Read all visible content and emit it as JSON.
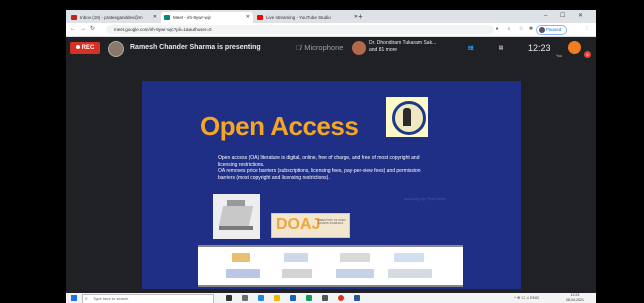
{
  "browser": {
    "tabs": [
      {
        "label": "Inbox (18) - prateeganddev@m",
        "icon_color": "#c5221f"
      },
      {
        "label": "Meet - irh-9ywr-wjc",
        "icon_color": "#00897b"
      },
      {
        "label": "Live streaming - YouTube Studio",
        "icon_color": "#ff0000"
      }
    ],
    "new_tab": "+",
    "url": "meet.google.com/irh-9ywr-wjc?pli=1&authuser=0",
    "profile_label": "Paused",
    "window_controls": [
      "–",
      "☐",
      "✕"
    ]
  },
  "meet": {
    "rec_label": "REC",
    "presenter": "Ramesh Chander Sharma is presenting",
    "microphone_label": "Microphone",
    "speaker_name": "Dr. Dhondiram Tukaram Sak...",
    "speaker_more": "and 81 more",
    "clock": "12:23",
    "user_badge": "5",
    "controls": [
      {
        "label": "Meeting details"
      },
      {
        "label": "Chat"
      }
    ],
    "thumb_label": "You"
  },
  "slide": {
    "title": "Open Access",
    "body_line1": "Open access (OA) literature is digital, online, free of charge, and free of most copyright and licensing restrictions.",
    "body_line2": "OA removes price barriers (subscriptions, licensing fees, pay-per-view fees) and permission barriers (most copyright and licensing restrictions).",
    "faint_text": "www.doaj.org / Peter Suber",
    "doaj_logo": "DOAJ",
    "doaj_sub": "DIRECTORY OF OPEN ACCESS JOURNALS",
    "logos": [
      "DOAJ",
      "OAPEN",
      "Springer",
      "OpenEdition",
      "Global Access",
      "Open Library"
    ]
  },
  "taskbar": {
    "search_placeholder": "Type here to search",
    "time": "12:23",
    "date": "08-04-2021",
    "tray": "^ ⊕ ☐ ♫ ENG"
  }
}
